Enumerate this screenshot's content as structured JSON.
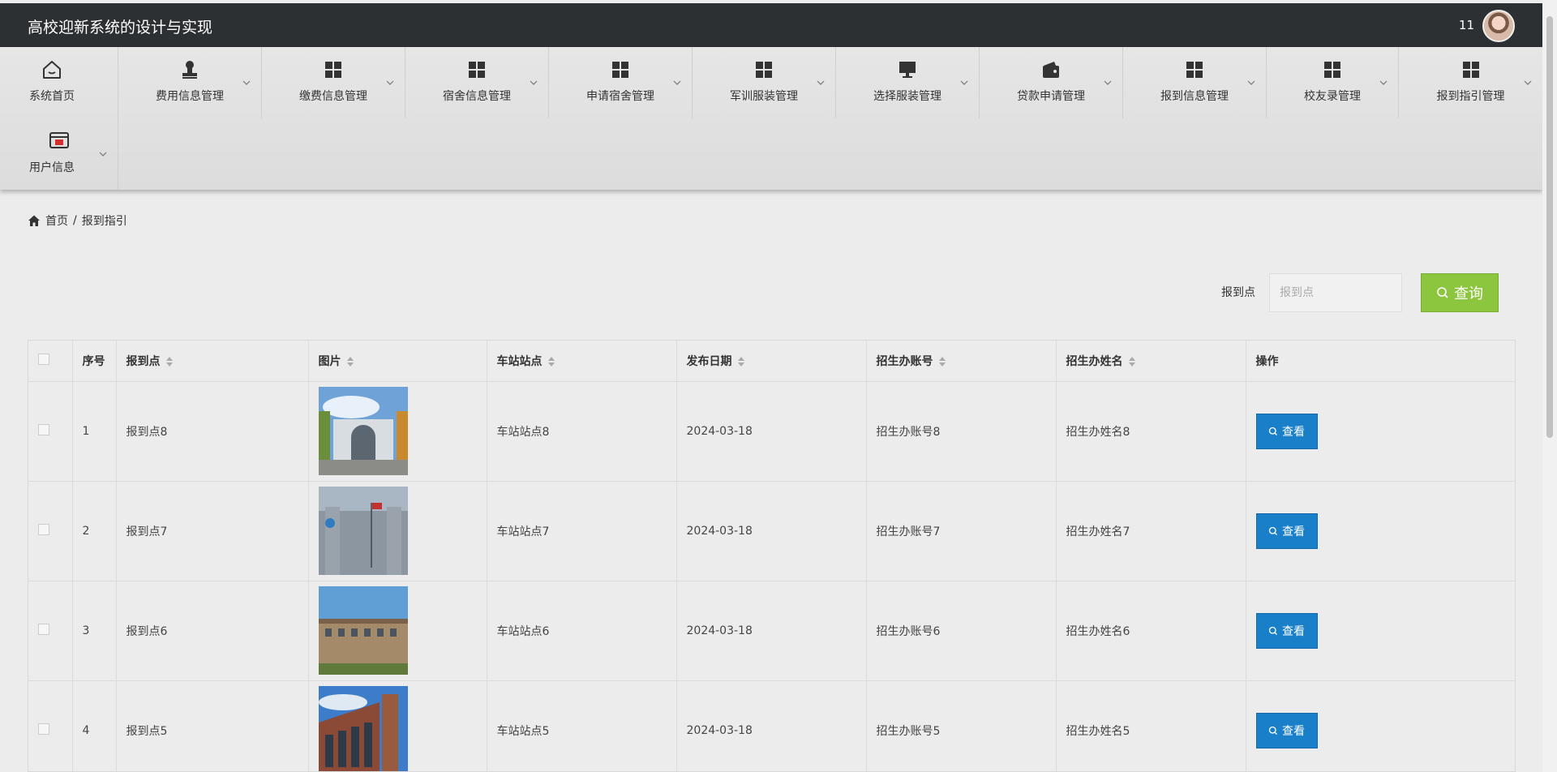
{
  "header": {
    "title": "高校迎新系统的设计与实现",
    "username": "11"
  },
  "nav": {
    "home": "系统首页",
    "items": [
      {
        "label": "费用信息管理",
        "icon": "stamp-icon"
      },
      {
        "label": "缴费信息管理",
        "icon": "grid-icon"
      },
      {
        "label": "宿舍信息管理",
        "icon": "grid-icon"
      },
      {
        "label": "申请宿舍管理",
        "icon": "grid-icon"
      },
      {
        "label": "军训服装管理",
        "icon": "grid-icon"
      },
      {
        "label": "选择服装管理",
        "icon": "monitor-icon"
      },
      {
        "label": "贷款申请管理",
        "icon": "wallet-icon"
      },
      {
        "label": "报到信息管理",
        "icon": "grid-icon"
      },
      {
        "label": "校友录管理",
        "icon": "grid-icon"
      },
      {
        "label": "报到指引管理",
        "icon": "grid-icon"
      }
    ],
    "user": "用户信息"
  },
  "breadcrumb": {
    "home": "首页",
    "sep": "/",
    "current": "报到指引"
  },
  "search": {
    "label": "报到点",
    "placeholder": "报到点",
    "button": "查询"
  },
  "table": {
    "headers": [
      "序号",
      "报到点",
      "图片",
      "车站站点",
      "发布日期",
      "招生办账号",
      "招生办姓名",
      "操作"
    ],
    "rows": [
      {
        "no": "1",
        "point": "报到点8",
        "station": "车站站点8",
        "date": "2024-03-18",
        "account": "招生办账号8",
        "name": "招生办姓名8",
        "action": "查看"
      },
      {
        "no": "2",
        "point": "报到点7",
        "station": "车站站点7",
        "date": "2024-03-18",
        "account": "招生办账号7",
        "name": "招生办姓名7",
        "action": "查看"
      },
      {
        "no": "3",
        "point": "报到点6",
        "station": "车站站点6",
        "date": "2024-03-18",
        "account": "招生办账号6",
        "name": "招生办姓名6",
        "action": "查看"
      },
      {
        "no": "4",
        "point": "报到点5",
        "station": "车站站点5",
        "date": "2024-03-18",
        "account": "招生办账号5",
        "name": "招生办姓名5",
        "action": "查看"
      }
    ]
  },
  "colors": {
    "topbar": "#2d3033",
    "search_button": "#8cc63e",
    "view_button": "#1a7fc9"
  }
}
